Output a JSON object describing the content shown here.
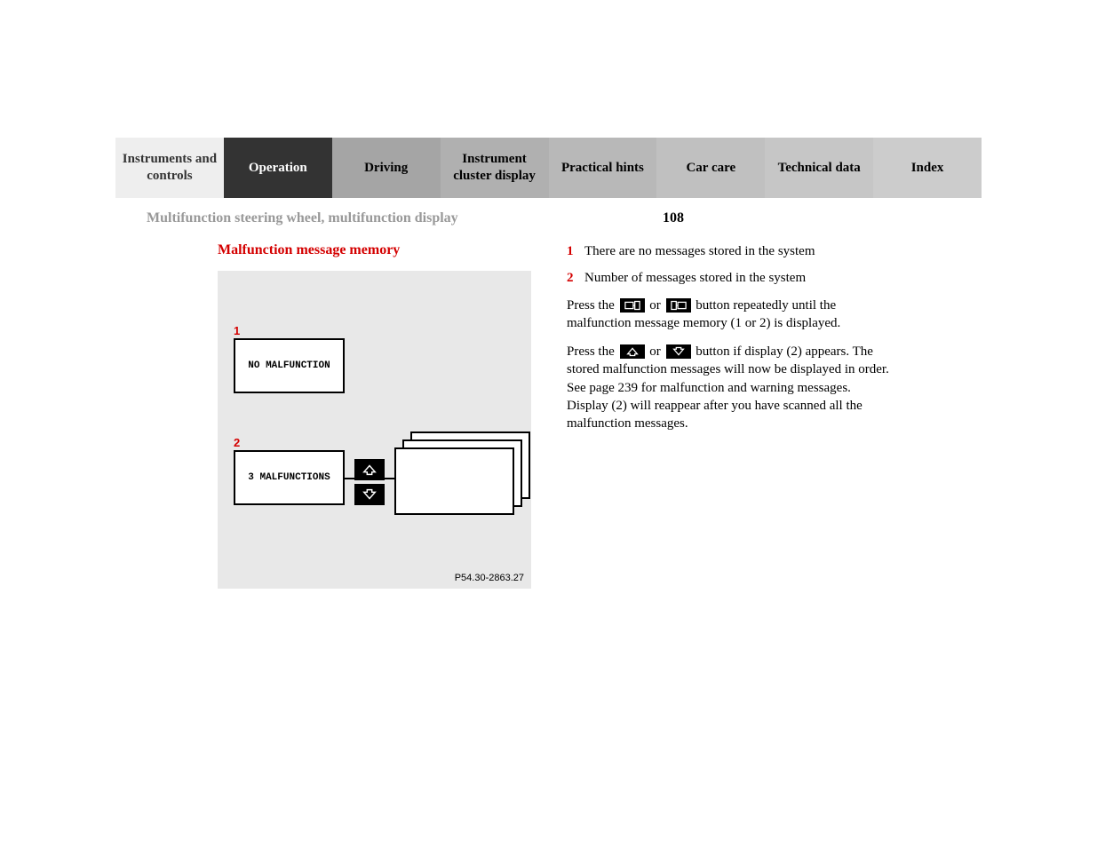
{
  "tabs": [
    {
      "label": "Instruments and controls"
    },
    {
      "label": "Operation"
    },
    {
      "label": "Driving"
    },
    {
      "label": "Instrument cluster display"
    },
    {
      "label": "Practical hints"
    },
    {
      "label": "Car care"
    },
    {
      "label": "Technical data"
    },
    {
      "label": "Index"
    }
  ],
  "subheader": {
    "title": "Multifunction steering wheel, multifunction display",
    "page": "108"
  },
  "section_heading": "Malfunction message memory",
  "diagram": {
    "box1_text": "NO MALFUNCTION",
    "box2_text": "3 MALFUNCTIONS",
    "callout1": "1",
    "callout2": "2",
    "figure_code": "P54.30-2863.27"
  },
  "legend": [
    {
      "num": "1",
      "text": "There are no messages stored in the system"
    },
    {
      "num": "2",
      "text": "Number of messages stored in the system"
    }
  ],
  "para1_a": "Press the",
  "para1_b": "or",
  "para1_c": "button repeatedly until the malfunction message memory (1 or 2) is displayed.",
  "para2_a": "Press the",
  "para2_b": "or",
  "para2_c": "button if display (2) appears. The stored malfunction messages will now be displayed in order. See page 239 for malfunction and warning messages.",
  "para2_d": "Display (2) will reappear after you have scanned all the malfunction messages."
}
